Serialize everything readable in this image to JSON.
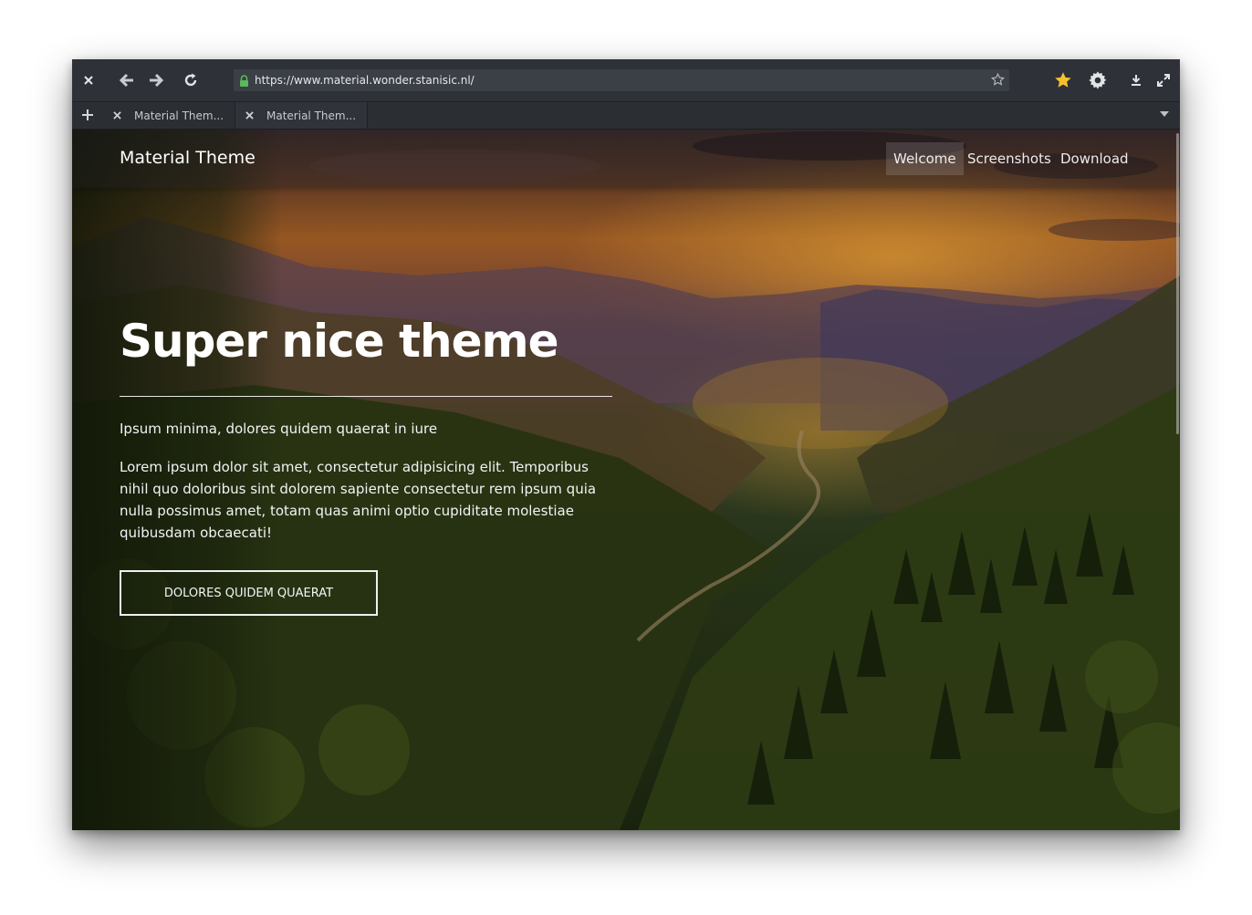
{
  "browser": {
    "url": "https://www.material.wonder.stanisic.nl/",
    "tabs": [
      {
        "title": "Material Them..."
      },
      {
        "title": "Material Them..."
      }
    ]
  },
  "icons": {
    "close": "close-icon",
    "back": "arrow-left-icon",
    "forward": "arrow-right-icon",
    "reload": "reload-icon",
    "lock": "lock-icon",
    "bookmark": "star-outline-icon",
    "favorites": "star-filled-icon",
    "settings": "gear-icon",
    "download": "download-icon",
    "fullscreen": "expand-icon",
    "new_tab": "plus-icon",
    "tab_menu": "chevron-down-icon"
  },
  "colors": {
    "lock": "#5cb85c",
    "star": "#f5c12e",
    "chrome": "#2e3137"
  },
  "site": {
    "brand": "Material Theme",
    "nav": [
      {
        "label": "Welcome",
        "active": true
      },
      {
        "label": "Screenshots",
        "active": false
      },
      {
        "label": "Download",
        "active": false
      }
    ],
    "hero": {
      "title": "Super nice theme",
      "subtitle": "Ipsum minima, dolores quidem quaerat in iure",
      "body": "Lorem ipsum dolor sit amet, consectetur adipisicing elit. Temporibus nihil quo doloribus sint dolorem sapiente consectetur rem ipsum quia nulla possimus amet, totam quas animi optio cupiditate molestiae quibusdam obcaecati!",
      "button": "DOLORES QUIDEM QUAERAT"
    }
  }
}
